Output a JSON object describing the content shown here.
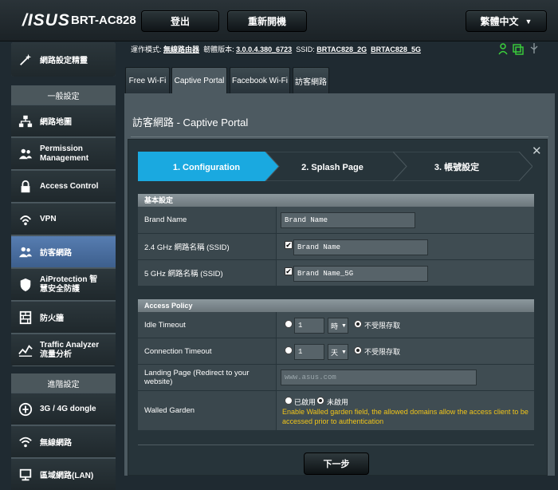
{
  "header": {
    "logo": "/ISUS",
    "model": "BRT-AC828",
    "logout_label": "登出",
    "reboot_label": "重新開機",
    "language_label": "繁體中文"
  },
  "status": {
    "mode_prefix": "運作模式:",
    "mode_value": "無線路由器",
    "fw_prefix": "韌體版本:",
    "fw_value": "3.0.0.4.380_6723",
    "ssid_prefix": "SSID:",
    "ssid_2g": "BRTAC828_2G",
    "ssid_5g": "BRTAC828_5G"
  },
  "sidebar": {
    "wizard": "網路設定精靈",
    "general_header": "一般設定",
    "general_items": [
      {
        "label": "網路地圖",
        "icon": "network-map-icon"
      },
      {
        "label": "Permission Management",
        "icon": "users-icon"
      },
      {
        "label": "Access Control",
        "icon": "lock-icon"
      },
      {
        "label": "VPN",
        "icon": "vpn-icon"
      },
      {
        "label": "訪客網路",
        "icon": "guest-network-icon"
      },
      {
        "label": "AiProtection 智慧安全防護",
        "icon": "shield-icon"
      },
      {
        "label": "防火牆",
        "icon": "firewall-icon"
      },
      {
        "label": "Traffic Analyzer 流量分析",
        "icon": "traffic-icon"
      }
    ],
    "advanced_header": "進階設定",
    "advanced_items": [
      {
        "label": "3G / 4G dongle",
        "icon": "dongle-icon"
      },
      {
        "label": "無線網路",
        "icon": "wifi-icon"
      },
      {
        "label": "區域網路(LAN)",
        "icon": "lan-icon"
      }
    ]
  },
  "tabs": [
    "Free Wi-Fi",
    "Captive Portal",
    "Facebook Wi-Fi",
    "訪客網路"
  ],
  "page": {
    "title": "訪客網路 - Captive Portal",
    "steps": [
      "1. Configuration",
      "2. Splash Page",
      "3. 帳號設定"
    ]
  },
  "basic": {
    "header": "基本設定",
    "brand_label": "Brand Name",
    "brand_value": "Brand Name",
    "ssid24_label": "2.4 GHz 網路名稱 (SSID)",
    "ssid24_value": "Brand Name",
    "ssid5_label": "5 GHz 網路名稱 (SSID)",
    "ssid5_value": "Brand Name_5G"
  },
  "policy": {
    "header": "Access Policy",
    "idle_label": "Idle Timeout",
    "idle_value": "1",
    "idle_unit": "時",
    "idle_unlimited": "不受限存取",
    "conn_label": "Connection Timeout",
    "conn_value": "1",
    "conn_unit": "天",
    "conn_unlimited": "不受限存取",
    "landing_label": "Landing Page (Redirect to your website)",
    "landing_placeholder": "www.asus.com",
    "walled_label": "Walled Garden",
    "enabled_label": "已啟用",
    "disabled_label": "未啟用",
    "walled_note": "Enable Walled garden field, the allowed domains allow the access client to be accessed prior to authentication"
  },
  "next_label": "下一步",
  "colors": {
    "accent": "#1aa9e0",
    "warning": "#f0c419",
    "active_nav": "#4f73a6"
  }
}
